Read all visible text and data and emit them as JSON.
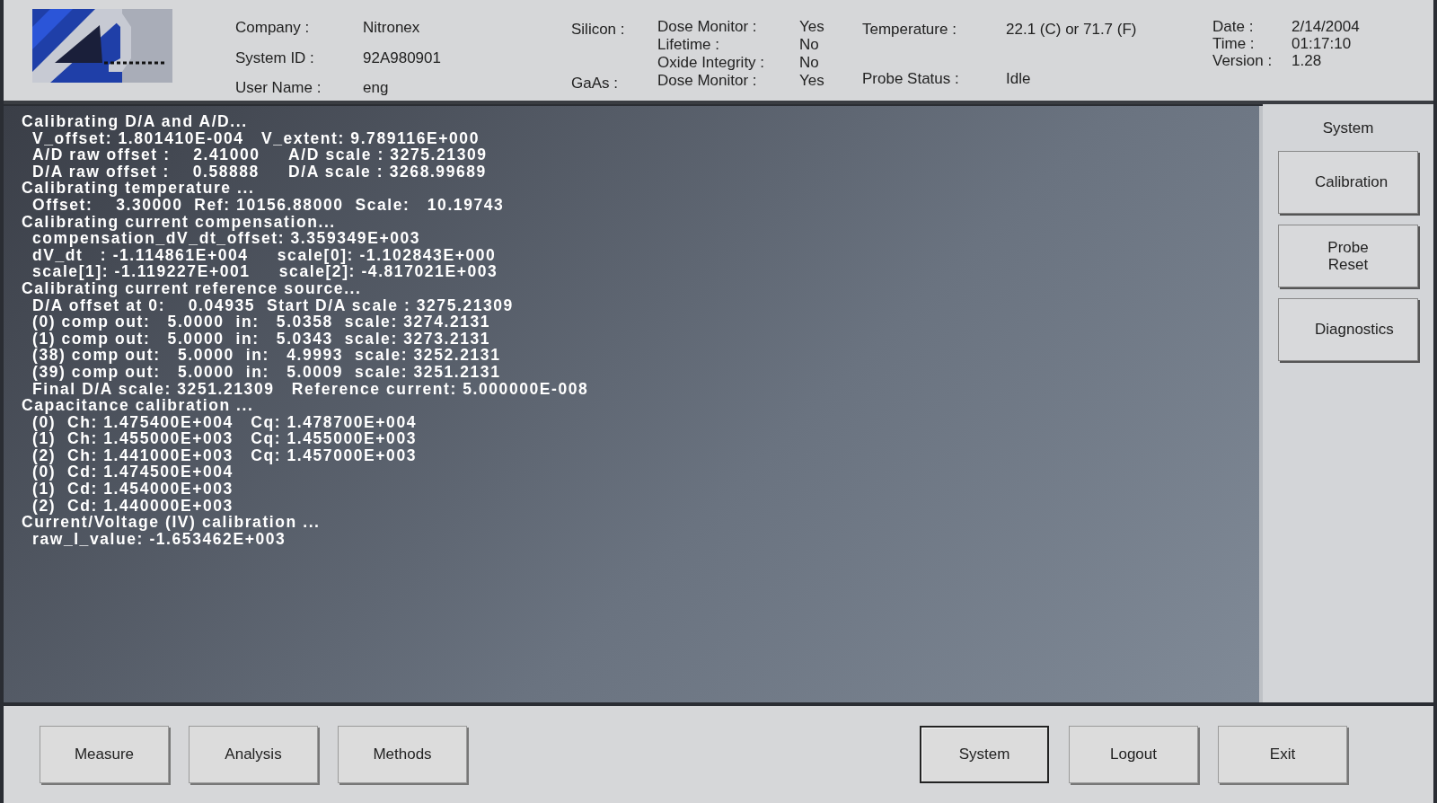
{
  "header": {
    "identity": [
      {
        "label": "Company :",
        "value": "Nitronex"
      },
      {
        "label": "System ID :",
        "value": "92A980901"
      },
      {
        "label": "User Name :",
        "value": "eng"
      }
    ],
    "materials": [
      {
        "label": "Silicon :",
        "items": [
          {
            "label": "Dose Monitor :",
            "value": "Yes"
          },
          {
            "label": "Lifetime :",
            "value": "No"
          },
          {
            "label": "Oxide Integrity :",
            "value": "No"
          }
        ]
      },
      {
        "label": "GaAs :",
        "items": [
          {
            "label": "Dose Monitor :",
            "value": "Yes"
          }
        ]
      }
    ],
    "temperature": {
      "label": "Temperature :",
      "value": "22.1 (C) or 71.7 (F)"
    },
    "probe_status": {
      "label": "Probe Status :",
      "value": "Idle"
    },
    "clock": [
      {
        "label": "Date :",
        "value": "2/14/2004"
      },
      {
        "label": "Time :",
        "value": "01:17:10"
      },
      {
        "label": "Version :",
        "value": "1.28"
      }
    ]
  },
  "log": [
    {
      "kind": "heading",
      "text": "Calibrating D/A and A/D..."
    },
    {
      "kind": "detail",
      "text": "V_offset: 1.801410E-004   V_extent: 9.789116E+000"
    },
    {
      "kind": "detail",
      "text": "A/D raw offset :    2.41000     A/D scale : 3275.21309"
    },
    {
      "kind": "detail",
      "text": "D/A raw offset :    0.58888     D/A scale : 3268.99689"
    },
    {
      "kind": "heading",
      "text": "Calibrating temperature ..."
    },
    {
      "kind": "detail",
      "text": "Offset:    3.30000  Ref: 10156.88000  Scale:   10.19743"
    },
    {
      "kind": "heading",
      "text": "Calibrating current compensation..."
    },
    {
      "kind": "detail",
      "text": "compensation_dV_dt_offset: 3.359349E+003"
    },
    {
      "kind": "detail",
      "text": "dV_dt   : -1.114861E+004     scale[0]: -1.102843E+000"
    },
    {
      "kind": "detail",
      "text": "scale[1]: -1.119227E+001     scale[2]: -4.817021E+003"
    },
    {
      "kind": "heading",
      "text": "Calibrating current reference source..."
    },
    {
      "kind": "detail",
      "text": "D/A offset at 0:    0.04935  Start D/A scale : 3275.21309"
    },
    {
      "kind": "detail",
      "text": "(0) comp out:   5.0000  in:   5.0358  scale: 3274.2131"
    },
    {
      "kind": "detail",
      "text": "(1) comp out:   5.0000  in:   5.0343  scale: 3273.2131"
    },
    {
      "kind": "detail",
      "text": "(38) comp out:   5.0000  in:   4.9993  scale: 3252.2131"
    },
    {
      "kind": "detail",
      "text": "(39) comp out:   5.0000  in:   5.0009  scale: 3251.2131"
    },
    {
      "kind": "detail",
      "text": "Final D/A scale: 3251.21309   Reference current: 5.000000E-008"
    },
    {
      "kind": "heading",
      "text": "Capacitance calibration ..."
    },
    {
      "kind": "detail",
      "text": "(0)  Ch: 1.475400E+004   Cq: 1.478700E+004"
    },
    {
      "kind": "detail",
      "text": "(1)  Ch: 1.455000E+003   Cq: 1.455000E+003"
    },
    {
      "kind": "detail",
      "text": "(2)  Ch: 1.441000E+003   Cq: 1.457000E+003"
    },
    {
      "kind": "detail",
      "text": "(0)  Cd: 1.474500E+004"
    },
    {
      "kind": "detail",
      "text": "(1)  Cd: 1.454000E+003"
    },
    {
      "kind": "detail",
      "text": "(2)  Cd: 1.440000E+003"
    },
    {
      "kind": "heading",
      "text": "Current/Voltage (IV) calibration ..."
    },
    {
      "kind": "detail",
      "text": "raw_I_value: -1.653462E+003"
    }
  ],
  "side_panel": {
    "title": "System",
    "buttons": [
      "Calibration",
      "Probe Reset",
      "Diagnostics"
    ]
  },
  "nav_left": [
    {
      "label": "Measure",
      "selected": false
    },
    {
      "label": "Analysis",
      "selected": false
    },
    {
      "label": "Methods",
      "selected": false
    }
  ],
  "nav_right": [
    {
      "label": "System",
      "selected": true
    },
    {
      "label": "Logout",
      "selected": false
    },
    {
      "label": "Exit",
      "selected": false
    }
  ]
}
